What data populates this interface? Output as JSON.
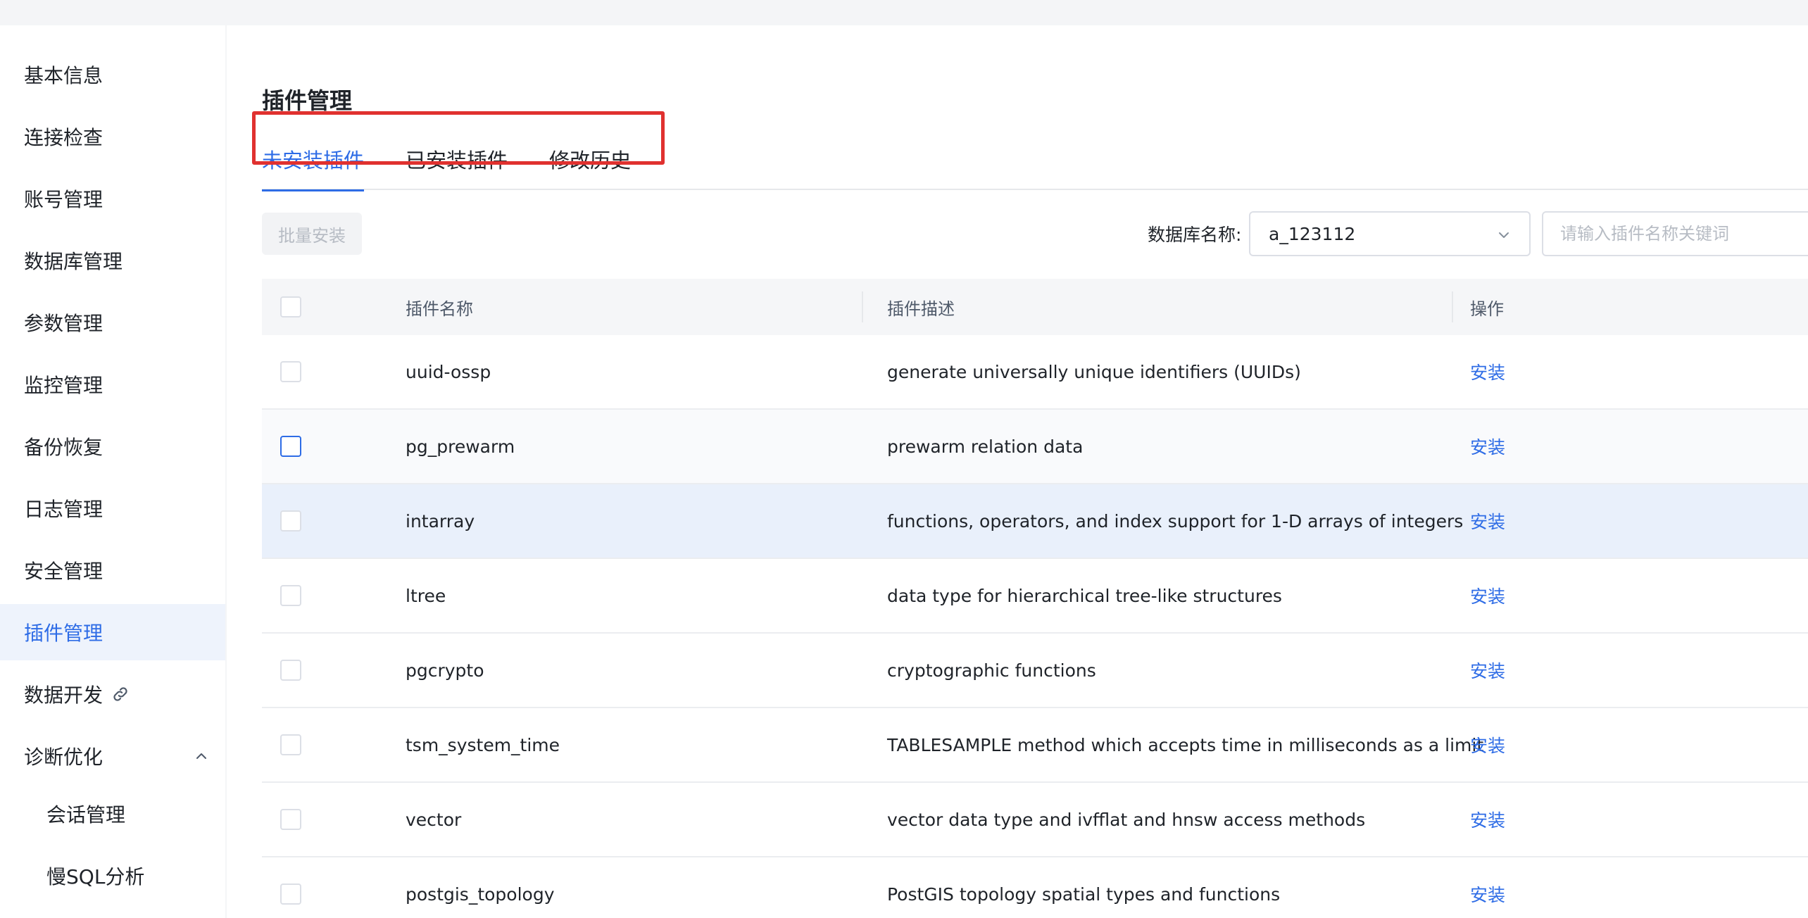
{
  "sidebar": {
    "items": [
      {
        "label": "基本信息"
      },
      {
        "label": "连接检查"
      },
      {
        "label": "账号管理"
      },
      {
        "label": "数据库管理"
      },
      {
        "label": "参数管理"
      },
      {
        "label": "监控管理"
      },
      {
        "label": "备份恢复"
      },
      {
        "label": "日志管理"
      },
      {
        "label": "安全管理"
      },
      {
        "label": "插件管理",
        "active": true
      },
      {
        "label": "数据开发",
        "icon": "link-icon"
      },
      {
        "label": "诊断优化",
        "icon": "chevron-up-icon",
        "expanded": true
      },
      {
        "label": "会话管理",
        "sub": true
      },
      {
        "label": "慢SQL分析",
        "sub": true
      }
    ]
  },
  "main": {
    "title": "插件管理",
    "tabs": [
      {
        "label": "未安装插件",
        "active": true
      },
      {
        "label": "已安装插件"
      },
      {
        "label": "修改历史"
      }
    ],
    "toolbar": {
      "batch_install": "批量安装",
      "db_label": "数据库名称:",
      "db_value": "a_123112",
      "search_placeholder": "请输入插件名称关键词"
    },
    "table": {
      "headers": {
        "name": "插件名称",
        "desc": "插件描述",
        "op": "操作"
      },
      "rows": [
        {
          "name": "uuid-ossp",
          "desc": "generate universally unique identifiers (UUIDs)",
          "op": "安装"
        },
        {
          "name": "pg_prewarm",
          "desc": "prewarm relation data",
          "op": "安装"
        },
        {
          "name": "intarray",
          "desc": "functions, operators, and index support for 1-D arrays of integers",
          "op": "安装"
        },
        {
          "name": "ltree",
          "desc": "data type for hierarchical tree-like structures",
          "op": "安装"
        },
        {
          "name": "pgcrypto",
          "desc": "cryptographic functions",
          "op": "安装"
        },
        {
          "name": "tsm_system_time",
          "desc": "TABLESAMPLE method which accepts time in milliseconds as a limit",
          "op": "安装"
        },
        {
          "name": "vector",
          "desc": "vector data type and ivfflat and hnsw access methods",
          "op": "安装"
        },
        {
          "name": "postgis_topology",
          "desc": "PostGIS topology spatial types and functions",
          "op": "安装"
        }
      ]
    }
  },
  "colors": {
    "accent": "#2e6ce6",
    "highlight_box": "#e0312f",
    "active_bg": "#eef3fc"
  }
}
